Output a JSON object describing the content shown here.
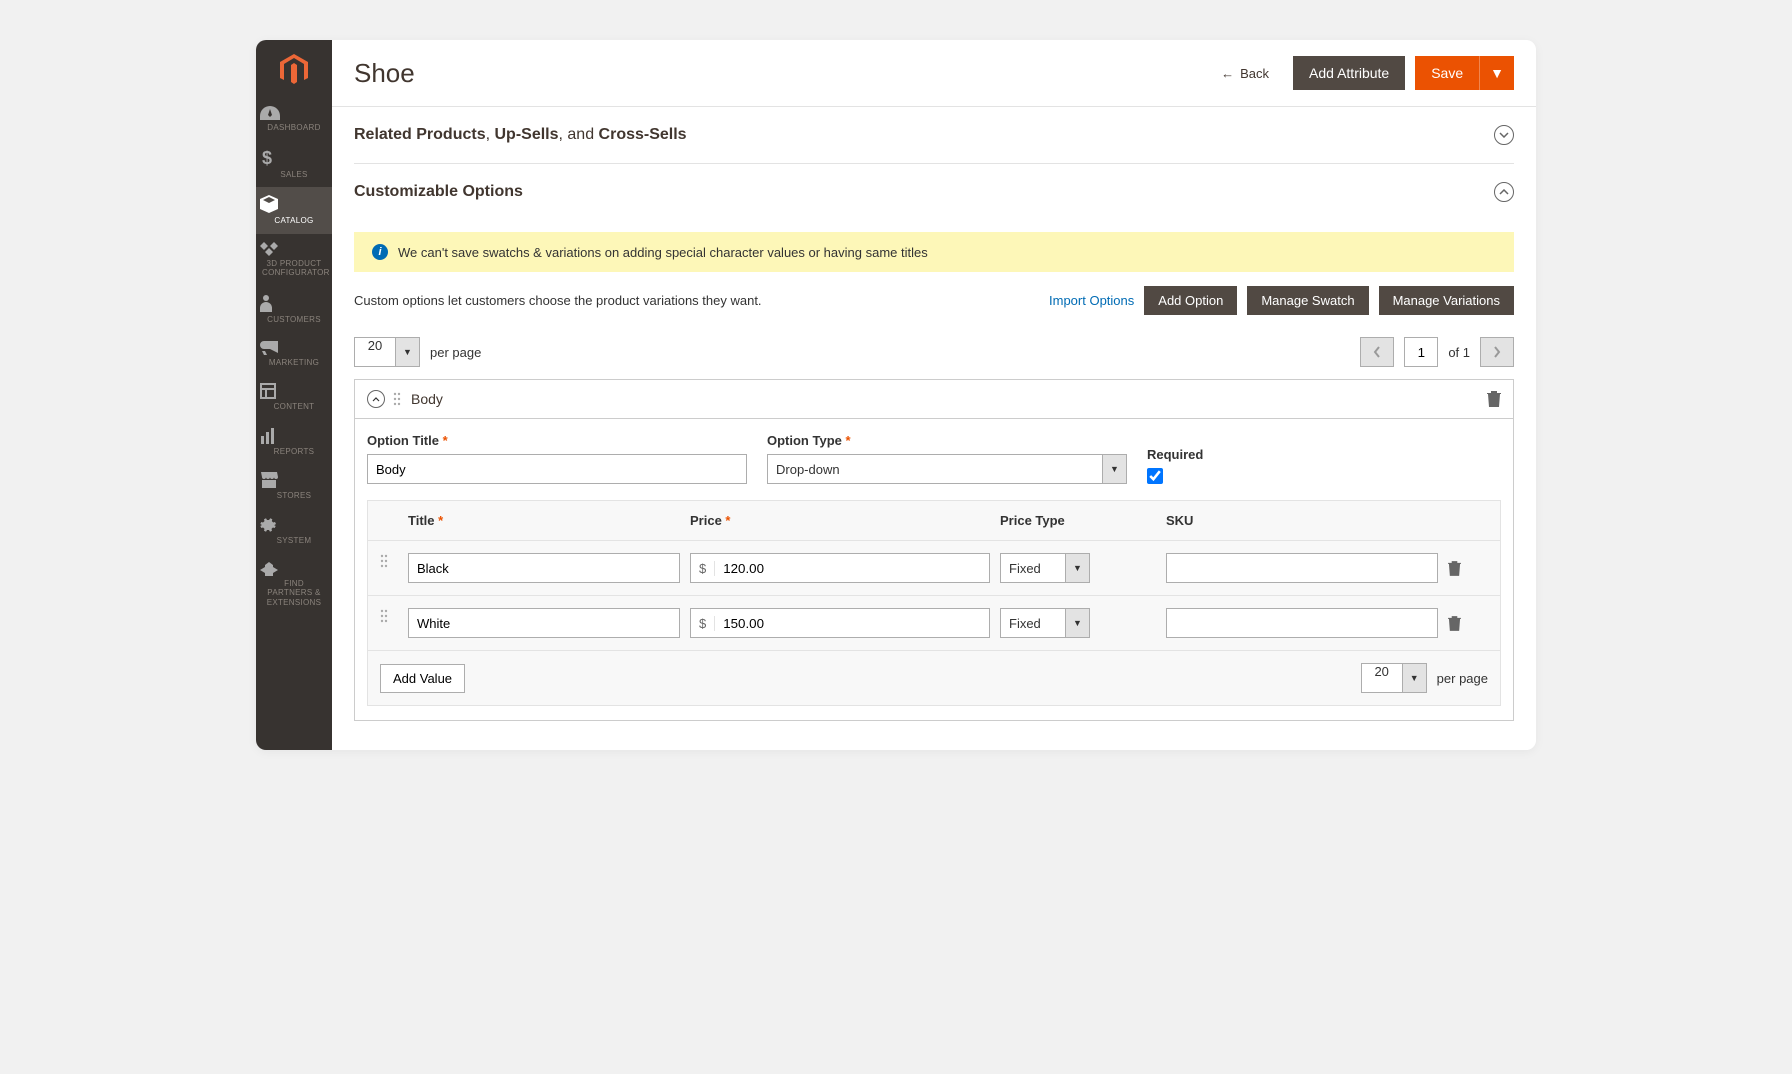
{
  "header": {
    "title": "Shoe",
    "back": "Back",
    "add_attribute": "Add Attribute",
    "save": "Save"
  },
  "sidebar": [
    {
      "label": "DASHBOARD"
    },
    {
      "label": "SALES"
    },
    {
      "label": "CATALOG"
    },
    {
      "label": "3D PRODUCT CONFIGURATOR"
    },
    {
      "label": "CUSTOMERS"
    },
    {
      "label": "MARKETING"
    },
    {
      "label": "CONTENT"
    },
    {
      "label": "REPORTS"
    },
    {
      "label": "STORES"
    },
    {
      "label": "SYSTEM"
    },
    {
      "label": "FIND PARTNERS & EXTENSIONS"
    }
  ],
  "sections": {
    "related": {
      "title_bold1": "Related Products",
      "title_bold2": "Up-Sells",
      "title_bold3": "Cross-Sells",
      "comma": ", ",
      "and": ", and "
    },
    "custom": {
      "title": "Customizable Options"
    }
  },
  "notice": "We can't save swatchs & variations on adding special character values or having same titles",
  "options_desc": "Custom options let customers choose the product variations they want.",
  "actions": {
    "import": "Import Options",
    "add_option": "Add Option",
    "manage_swatch": "Manage Swatch",
    "manage_variations": "Manage Variations"
  },
  "pager": {
    "per_page_value": "20",
    "per_page_label": "per page",
    "page": "1",
    "of": "of 1"
  },
  "option": {
    "name": "Body",
    "labels": {
      "title": "Option Title",
      "type": "Option Type",
      "required": "Required"
    },
    "title_value": "Body",
    "type_value": "Drop-down"
  },
  "table": {
    "cols": {
      "title": "Title",
      "price": "Price",
      "ptype": "Price Type",
      "sku": "SKU"
    },
    "currency": "$",
    "rows": [
      {
        "title": "Black",
        "price": "120.00",
        "ptype": "Fixed",
        "sku": ""
      },
      {
        "title": "White",
        "price": "150.00",
        "ptype": "Fixed",
        "sku": ""
      }
    ],
    "add_value": "Add Value"
  }
}
